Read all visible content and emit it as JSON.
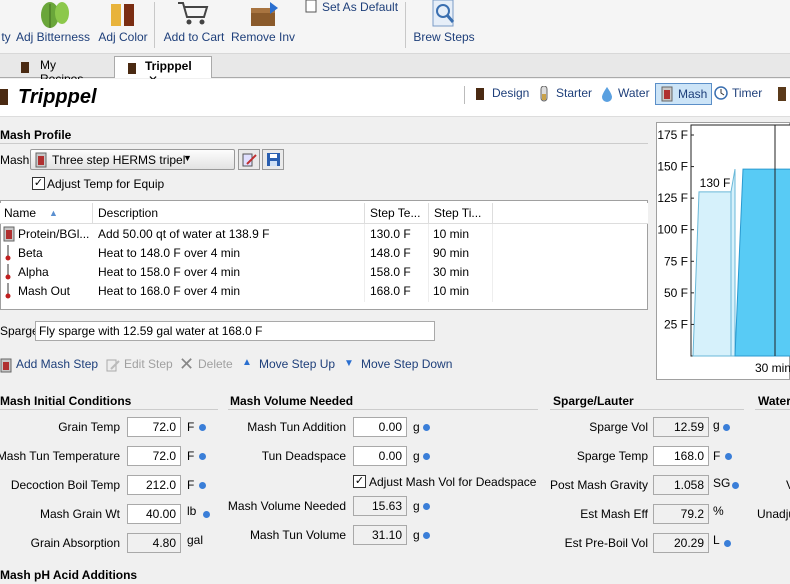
{
  "toolbar": {
    "adj_gravity": "ty",
    "adj_bitterness": "Adj Bitterness",
    "adj_color": "Adj Color",
    "add_to_cart": "Add to Cart",
    "remove_inv": "Remove Inv",
    "set_as_default": "Set As Default",
    "brew_steps": "Brew Steps"
  },
  "tabs": [
    {
      "label": "My Recipes"
    },
    {
      "label": "Tripppel",
      "close": "✕"
    }
  ],
  "recipe": {
    "title": "Tripppel"
  },
  "nav": {
    "design": "Design",
    "starter": "Starter",
    "water": "Water",
    "mash": "Mash",
    "timer": "Timer"
  },
  "mash_profile": {
    "heading": "Mash Profile",
    "mash_label": "Mash",
    "profile_value": "Three step HERMS tripel",
    "adjust_temp_label": "Adjust Temp for Equip",
    "adjust_temp_checked": "✓"
  },
  "steps_table": {
    "columns": [
      "Name",
      "Description",
      "Step Te...",
      "Step Ti..."
    ],
    "rows": [
      {
        "name": "Protein/BGl...",
        "description": "Add 50.00 qt of water at 138.9 F",
        "temp": "130.0 F",
        "time": "10 min"
      },
      {
        "name": "Beta",
        "description": "Heat to 148.0 F over 4 min",
        "temp": "148.0 F",
        "time": "90 min"
      },
      {
        "name": "Alpha",
        "description": "Heat to 158.0 F over 4 min",
        "temp": "158.0 F",
        "time": "30 min"
      },
      {
        "name": "Mash Out",
        "description": "Heat to 168.0 F over 4 min",
        "temp": "168.0 F",
        "time": "10 min"
      }
    ]
  },
  "sparge": {
    "label": "Sparge",
    "value": "Fly sparge with 12.59 gal water at 168.0 F"
  },
  "actions": {
    "add": "Add Mash Step",
    "edit": "Edit Step",
    "delete": "Delete",
    "up": "Move Step Up",
    "down": "Move Step Down"
  },
  "initial": {
    "heading": "Mash Initial Conditions",
    "grain_temp": {
      "label": "Grain Temp",
      "value": "72.0",
      "unit": "F"
    },
    "tun_temp": {
      "label": "Mash Tun Temperature",
      "value": "72.0",
      "unit": "F"
    },
    "decoction": {
      "label": "Decoction Boil Temp",
      "value": "212.0",
      "unit": "F"
    },
    "grain_wt": {
      "label": "Mash Grain Wt",
      "value": "40.00",
      "unit": "lb"
    },
    "absorption": {
      "label": "Grain Absorption",
      "value": "4.80",
      "unit": "gal"
    }
  },
  "volume": {
    "heading": "Mash Volume Needed",
    "tun_addition": {
      "label": "Mash Tun Addition",
      "value": "0.00",
      "unit": "g"
    },
    "deadspace": {
      "label": "Tun Deadspace",
      "value": "0.00",
      "unit": "g"
    },
    "adjust_deadspace_label": "Adjust Mash Vol for Deadspace",
    "adjust_deadspace_checked": "✓",
    "needed": {
      "label": "Mash Volume Needed",
      "value": "15.63",
      "unit": "g"
    },
    "tun_volume": {
      "label": "Mash Tun Volume",
      "value": "31.10",
      "unit": "g"
    }
  },
  "lauter": {
    "heading": "Sparge/Lauter",
    "sparge_vol": {
      "label": "Sparge Vol",
      "value": "12.59",
      "unit": "g"
    },
    "sparge_temp": {
      "label": "Sparge Temp",
      "value": "168.0",
      "unit": "F"
    },
    "post_gravity": {
      "label": "Post Mash Gravity",
      "value": "1.058",
      "unit": "SG"
    },
    "mash_eff": {
      "label": "Est Mash Eff",
      "value": "79.2",
      "unit": "%"
    },
    "pre_boil": {
      "label": "Est Pre-Boil Vol",
      "value": "20.29",
      "unit": "L"
    }
  },
  "water_panel": {
    "heading": "Water",
    "v_label": "V",
    "unadj_label": "Unadju"
  },
  "ph_heading": "Mash pH Acid Additions",
  "chart_data": {
    "type": "area",
    "y_ticks": [
      "175 F",
      "150 F",
      "125 F",
      "100 F",
      "75 F",
      "50 F",
      "25 F"
    ],
    "ylim": [
      0,
      175
    ],
    "annotation": "130 F",
    "x_tick": "30 min",
    "steps": [
      {
        "temp": 130,
        "color": "#d6f1fb"
      },
      {
        "temp": 148,
        "color": "#58cbf5"
      }
    ]
  },
  "colors": {
    "accent": "#3a7ed8",
    "nav_selected": "#cce4f7",
    "link": "#1e3f7a"
  }
}
